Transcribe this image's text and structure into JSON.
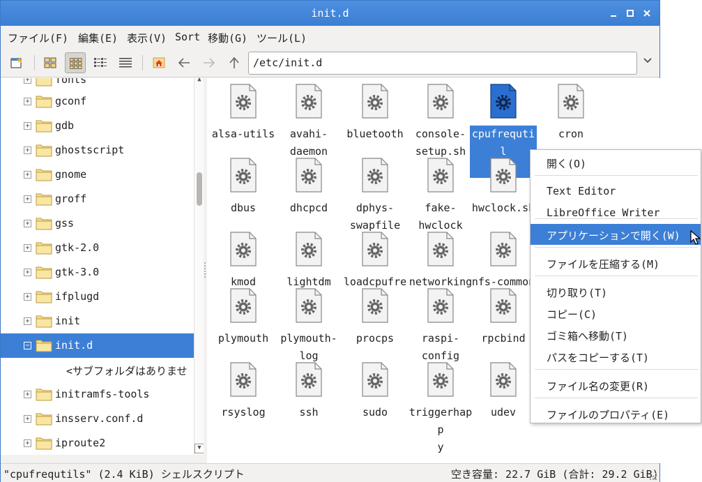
{
  "window": {
    "title": "init.d"
  },
  "menubar": {
    "items": [
      "ファイル(F)",
      "編集(E)",
      "表示(V)",
      "Sort",
      "移動(G)",
      "ツール(L)"
    ]
  },
  "toolbar": {
    "address": "/etc/init.d"
  },
  "sidebar": {
    "items": [
      {
        "label": "fonts",
        "expander": "+"
      },
      {
        "label": "gconf",
        "expander": "+"
      },
      {
        "label": "gdb",
        "expander": "+"
      },
      {
        "label": "ghostscript",
        "expander": "+"
      },
      {
        "label": "gnome",
        "expander": "+"
      },
      {
        "label": "groff",
        "expander": "+"
      },
      {
        "label": "gss",
        "expander": "+"
      },
      {
        "label": "gtk-2.0",
        "expander": "+"
      },
      {
        "label": "gtk-3.0",
        "expander": "+"
      },
      {
        "label": "ifplugd",
        "expander": "+"
      },
      {
        "label": "init",
        "expander": "+"
      },
      {
        "label": "init.d",
        "expander": "−"
      },
      {
        "label": "<サブフォルダはありませ",
        "expander": ""
      },
      {
        "label": "initramfs-tools",
        "expander": "+"
      },
      {
        "label": "insserv.conf.d",
        "expander": "+"
      },
      {
        "label": "iproute2",
        "expander": "+"
      }
    ]
  },
  "files": [
    "alsa-utils",
    "avahi-daemon",
    "bluetooth",
    "console-setup.sh",
    "cpufrequtils",
    "cron",
    "dbus",
    "dhcpcd",
    "dphys-swapfile",
    "fake-hwclock",
    "hwclock.sh",
    "kmod",
    "lightdm",
    "loadcpufreq",
    "networking",
    "nfs-common",
    "plymouth",
    "plymouth-log",
    "procps",
    "raspi-config",
    "rpcbind",
    "rsyslog",
    "ssh",
    "sudo",
    "triggerhappy",
    "udev"
  ],
  "file_name_lines": {
    "avahi-daemon": [
      "avahi-",
      "daemon"
    ],
    "console-setup.sh": [
      "console-",
      "setup.sh"
    ],
    "cpufrequtils": [
      "cpufrequtil",
      "s"
    ],
    "dphys-swapfile": [
      "dphys-",
      "swapfile"
    ],
    "fake-hwclock": [
      "fake-",
      "hwclock"
    ],
    "plymouth-log": [
      "plymouth-",
      "log"
    ],
    "raspi-config": [
      "raspi-",
      "config"
    ],
    "triggerhappy": [
      "triggerhapp",
      "y"
    ]
  },
  "selected_file": "cpufrequtils",
  "context_menu": {
    "items": [
      "開く(O)",
      "Text Editor",
      "LibreOffice Writer",
      "アプリケーションで開く(W)",
      "ファイルを圧縮する(M)",
      "切り取り(T)",
      "コピー(C)",
      "ゴミ箱へ移動(T)",
      "パスをコピーする(T)",
      "ファイル名の変更(R)",
      "ファイルのプロパティ(E)"
    ],
    "highlighted": "アプリケーションで開く(W)"
  },
  "statusbar": {
    "selection": "\"cpufrequtils\" (2.4 KiB) シェルスクリプト",
    "free_space": "空き容量: 22.7 GiB (合計: 29.2 GiB)"
  },
  "colors": {
    "accent": "#3c7fd6",
    "titlebar": "#4589dc",
    "folder": "#f7de8c"
  }
}
